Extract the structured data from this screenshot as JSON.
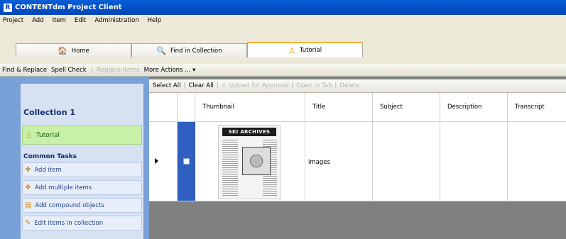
{
  "window": {
    "title": "CONTENTdm Project Client",
    "app_icon_glyph": "R"
  },
  "menu": [
    "Project",
    "Add",
    "Item",
    "Edit",
    "Administration",
    "Help"
  ],
  "tabs": [
    {
      "label": "Home",
      "icon": "home-icon",
      "active": false
    },
    {
      "label": "Find in Collection",
      "icon": "search-icon",
      "active": false
    },
    {
      "label": "Tutorial",
      "icon": "user-icon",
      "active": true
    }
  ],
  "toolbar": {
    "find_replace": "Find & Replace",
    "spell_check": "Spell Check",
    "replace_items": "Replace Items",
    "more_actions": "More Actions ... ▾"
  },
  "sidebar": {
    "collection_title": "Collection 1",
    "project_item": "Tutorial",
    "common_tasks_heading": "Common Tasks",
    "tasks": [
      {
        "label": "Add item",
        "icon": "add-item-icon"
      },
      {
        "label": "Add multiple items",
        "icon": "add-multiple-icon"
      },
      {
        "label": "Add compound objects",
        "icon": "compound-object-icon"
      },
      {
        "label": "Edit items in collection",
        "icon": "edit-items-icon"
      }
    ]
  },
  "grid_toolbar": {
    "select_all": "Select All",
    "clear_all": "Clear All",
    "upload": "Upload for Approval",
    "open_in_tab": "Open in Tab",
    "delete": "Delete"
  },
  "columns": [
    "Thumbnail",
    "Title",
    "Subject",
    "Description",
    "Transcript"
  ],
  "rows": [
    {
      "thumbnail_text": "SKI ARCHIVES",
      "title": "images",
      "subject": "",
      "description": "",
      "transcript": ""
    }
  ],
  "colors": {
    "titlebar": "#0352c8",
    "sidebar": "#7aa0d8",
    "tab_accent": "#f4b13a",
    "selection": "#2f5fbf"
  }
}
